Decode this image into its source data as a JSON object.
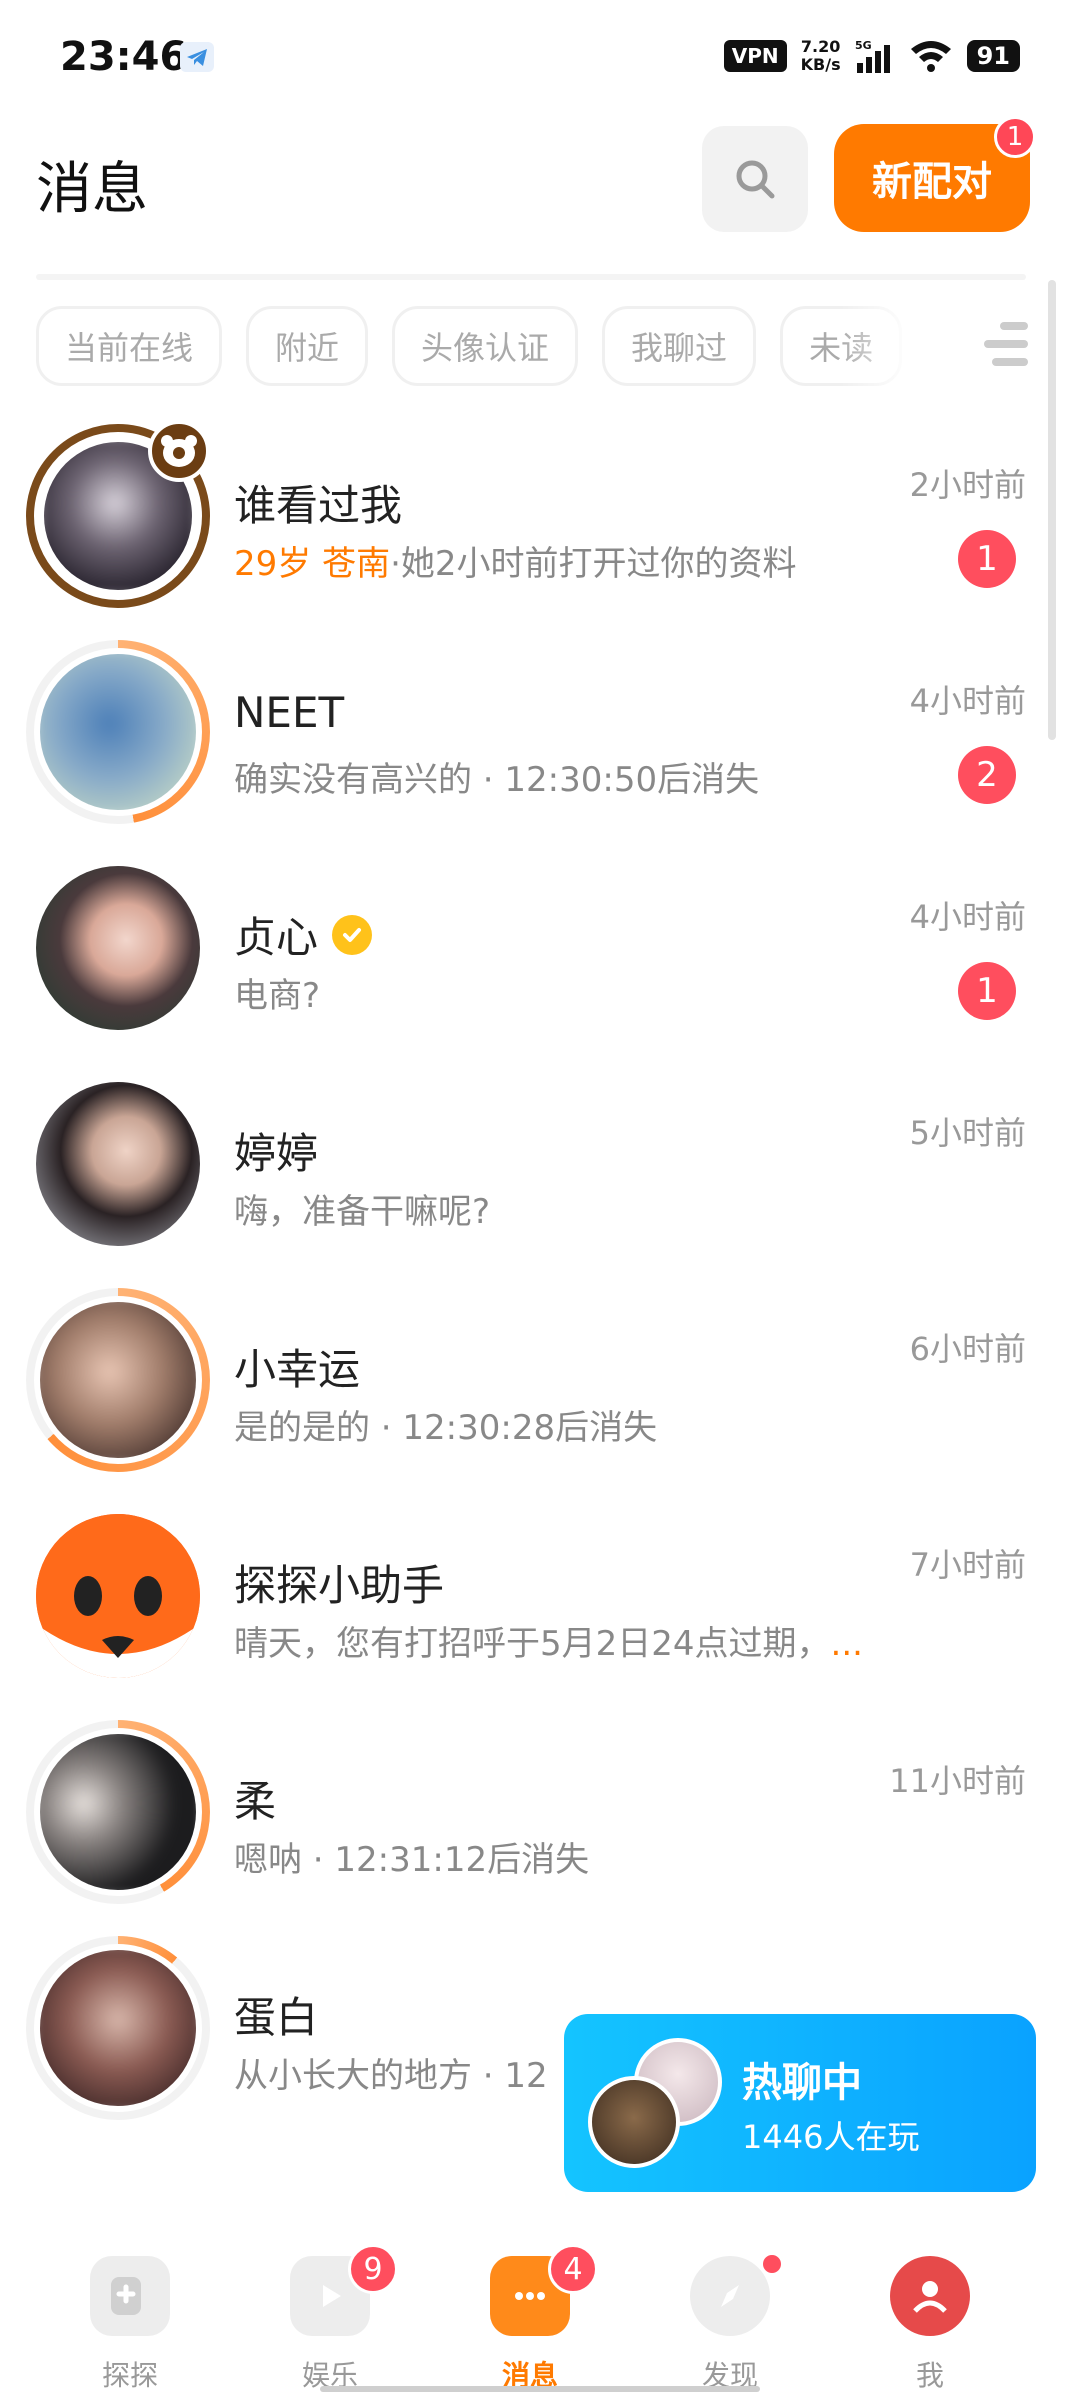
{
  "status_bar": {
    "time": "23:46",
    "vpn": "VPN",
    "speed_value": "7.20",
    "speed_unit": "KB/s",
    "network": "5G",
    "battery": "91"
  },
  "header": {
    "title": "消息",
    "new_match_label": "新配对",
    "new_match_badge": "1"
  },
  "filters": [
    "当前在线",
    "附近",
    "头像认证",
    "我聊过",
    "未读"
  ],
  "conversations": [
    {
      "name": "谁看过我",
      "preview_highlight": "29岁 苍南",
      "preview": "·她2小时前打开过你的资料",
      "time": "2小时前",
      "unread": "1",
      "avatar_color": "#3a3440"
    },
    {
      "name": "NEET",
      "preview": "确实没有高兴的 · 12:30:50后消失",
      "time": "4小时前",
      "unread": "2",
      "avatar_color": "#5b86b0"
    },
    {
      "name": "贞心",
      "preview": "电商?",
      "time": "4小时前",
      "unread": "1",
      "avatar_color": "#caa69a"
    },
    {
      "name": "婷婷",
      "preview": "嗨，准备干嘛呢?",
      "time": "5小时前",
      "unread": "",
      "avatar_color": "#b09084"
    },
    {
      "name": "小幸运",
      "preview": "是的是的 · 12:30:28后消失",
      "time": "6小时前",
      "unread": "",
      "avatar_color": "#8a6654"
    },
    {
      "name": "探探小助手",
      "preview": "晴天，您有打招呼于5月2日24点过期，",
      "preview_more": "...",
      "time": "7小时前",
      "unread": "",
      "avatar_color": "#ff6a1a"
    },
    {
      "name": "柔",
      "preview": "嗯呐 · 12:31:12后消失",
      "time": "11小时前",
      "unread": "",
      "avatar_color": "#2a2a2a"
    },
    {
      "name": "蛋白",
      "preview": "从小长大的地方 · 12",
      "time": "",
      "unread": "",
      "avatar_color": "#5a3a3a"
    }
  ],
  "hot_chat": {
    "title": "热聊中",
    "subtitle": "1446人在玩"
  },
  "bottom_nav": [
    {
      "label": "探探",
      "badge": ""
    },
    {
      "label": "娱乐",
      "badge": "9"
    },
    {
      "label": "消息",
      "badge": "4"
    },
    {
      "label": "发现",
      "badge": ""
    },
    {
      "label": "我",
      "badge": ""
    }
  ],
  "colors": {
    "accent": "#ff7a00",
    "badge": "#ff4e5e",
    "hot_chat": "#0aa2ff"
  }
}
